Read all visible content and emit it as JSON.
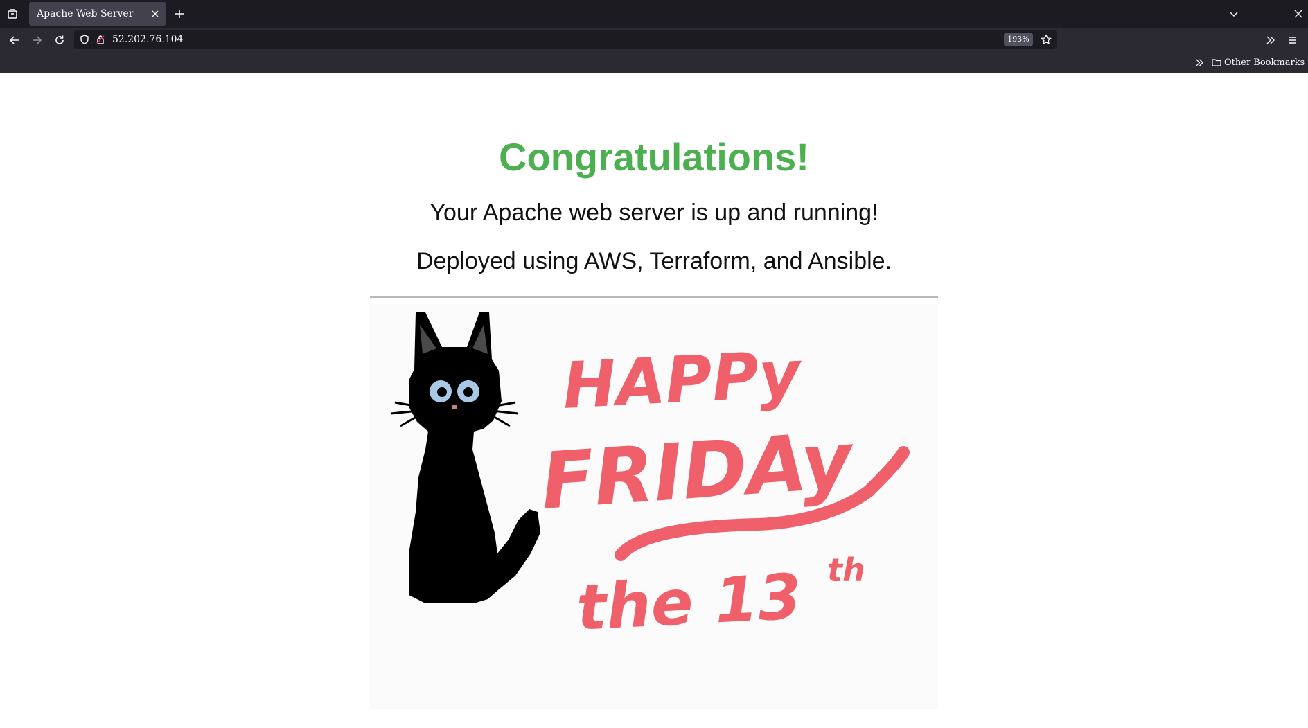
{
  "browser": {
    "tab": {
      "title": "Apache Web Server"
    },
    "address_bar": {
      "url": "52.202.76.104",
      "zoom": "193%"
    },
    "bookmarks_bar": {
      "folder_label": "Other Bookmarks"
    }
  },
  "page": {
    "heading": "Congratulations!",
    "paragraphs": [
      "Your Apache web server is up and running!",
      "Deployed using AWS, Terraform, and Ansible."
    ],
    "image": {
      "lines": [
        "HAPPy",
        "FRIDAy",
        "the 13",
        "th"
      ]
    }
  },
  "colors": {
    "heading": "#4caf50",
    "image_text": "#f0606a",
    "cat": "#000000",
    "cat_eyes": "#a9c8e6",
    "chrome_dark": "#1c1b22",
    "chrome": "#2b2a33"
  },
  "icons": [
    "tab-list-icon",
    "close-icon",
    "plus-icon",
    "chevron-down-icon",
    "back-arrow-icon",
    "forward-arrow-icon",
    "reload-icon",
    "shield-icon",
    "lock-icon",
    "star-icon",
    "double-chevron-icon",
    "menu-icon",
    "folder-icon"
  ]
}
